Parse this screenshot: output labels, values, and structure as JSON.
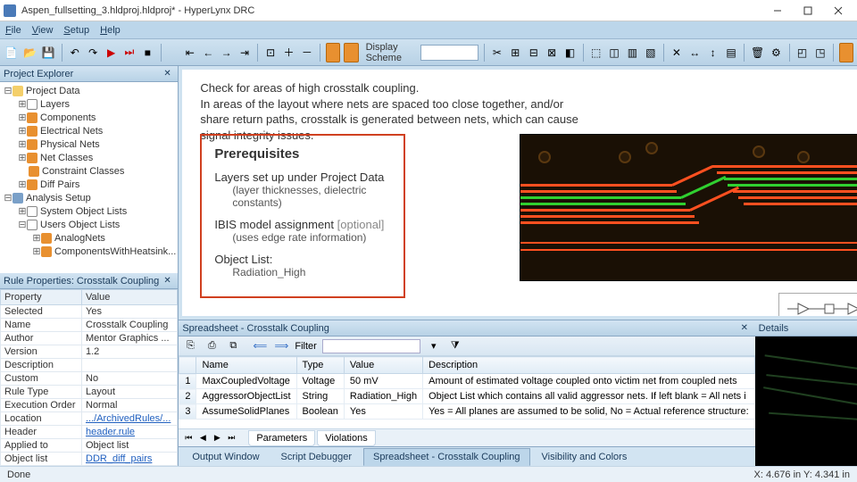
{
  "window": {
    "title": "Aspen_fullsetting_3.hldproj.hldproj* - HyperLynx DRC"
  },
  "menu": {
    "file": "File",
    "view": "View",
    "setup": "Setup",
    "help": "Help"
  },
  "toolbar": {
    "scheme_label": "Display Scheme"
  },
  "projectExplorer": {
    "title": "Project Explorer",
    "nodes": {
      "projectData": "Project Data",
      "layers": "Layers",
      "components": "Components",
      "electricalNets": "Electrical Nets",
      "physicalNets": "Physical Nets",
      "netClasses": "Net Classes",
      "constraintClasses": "Constraint Classes",
      "diffPairs": "Diff Pairs",
      "analysisSetup": "Analysis Setup",
      "systemObjLists": "System Object Lists",
      "usersObjLists": "Users Object Lists",
      "analogNets": "AnalogNets",
      "componentsWithHeatsink": "ComponentsWithHeatsink..."
    }
  },
  "ruleProps": {
    "title": "Rule Properties: Crosstalk Coupling",
    "headers": {
      "prop": "Property",
      "val": "Value"
    },
    "rows": [
      {
        "p": "Selected",
        "v": "Yes"
      },
      {
        "p": "Name",
        "v": "Crosstalk Coupling"
      },
      {
        "p": "Author",
        "v": "Mentor Graphics ..."
      },
      {
        "p": "Version",
        "v": "1.2"
      },
      {
        "p": "Description",
        "v": ""
      },
      {
        "p": "Custom",
        "v": "No"
      },
      {
        "p": "Rule Type",
        "v": "Layout"
      },
      {
        "p": "Execution Order",
        "v": "Normal"
      },
      {
        "p": "Location",
        "v": ".../ArchivedRules/..."
      },
      {
        "p": "Header",
        "v": "header.rule"
      },
      {
        "p": "Applied to",
        "v": "Object list"
      },
      {
        "p": "Object list",
        "v": "    DDR_diff_pairs"
      }
    ]
  },
  "doc": {
    "line1": "Check for areas of high crosstalk coupling.",
    "line2": "In areas of the layout where nets are spaced too close together, and/or",
    "line3": "share return paths, crosstalk is generated between nets, which can cause",
    "line4": "signal integrity issues.",
    "prereq": {
      "title": "Prerequisites",
      "l1": "Layers set up under Project Data",
      "l1b": "(layer thicknesses, dielectric constants)",
      "l2": "IBIS model assignment",
      "l2opt": "[optional]",
      "l2b": "(uses edge rate information)",
      "l3": "Object List:",
      "l3b": "Radiation_High"
    }
  },
  "spreadsheet": {
    "title": "Spreadsheet - Crosstalk Coupling",
    "filter_label": "Filter",
    "headers": {
      "name": "Name",
      "type": "Type",
      "value": "Value",
      "desc": "Description"
    },
    "rows": [
      {
        "n": "1",
        "name": "MaxCoupledVoltage",
        "type": "Voltage",
        "value": "50 mV",
        "desc": "Amount of estimated voltage coupled onto victim net from coupled nets"
      },
      {
        "n": "2",
        "name": "AggressorObjectList",
        "type": "String",
        "value": "Radiation_High",
        "desc": "Object List which contains all valid aggressor nets. If left blank = All nets i"
      },
      {
        "n": "3",
        "name": "AssumeSolidPlanes",
        "type": "Boolean",
        "value": "Yes",
        "desc": "Yes = All planes are assumed to be solid, No = Actual reference structure:"
      }
    ],
    "tabs": {
      "params": "Parameters",
      "viol": "Violations"
    }
  },
  "bottomTabs": {
    "output": "Output Window",
    "script": "Script Debugger",
    "spread": "Spreadsheet - Crosstalk Coupling",
    "vis": "Visibility and Colors"
  },
  "details": {
    "title": "Details"
  },
  "status": {
    "left": "Done",
    "right": "X: 4.676 in   Y: 4.341 in"
  }
}
